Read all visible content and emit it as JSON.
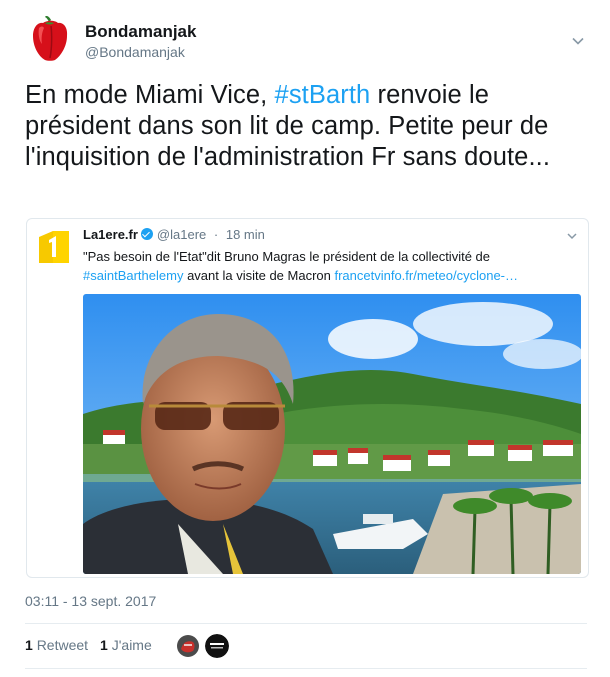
{
  "author": {
    "name": "Bondamanjak",
    "handle": "@Bondamanjak",
    "avatar_icon": "red-pepper-icon"
  },
  "tweet": {
    "text_before": "En mode Miami Vice, ",
    "hashtag": "#stBarth",
    "text_after": " renvoie le président dans son lit de camp. Petite peur de l'inquisition de l'administration Fr sans doute..."
  },
  "quoted": {
    "name": "La1ere.fr",
    "handle": "@la1ere",
    "separator": "·",
    "time": "18 min",
    "text_part1": "\"Pas besoin de l'Etat\"dit Bruno Magras le président de la collectivité de ",
    "hashtag": "#saintBarthelemy",
    "text_part2": " avant la visite de Macron ",
    "link": "francetvinfo.fr/meteo/cyclone-…",
    "logo_icon": "la1ere-logo-icon",
    "image_alt": "Man with sunglasses in front of harbor"
  },
  "timestamp": "03:11 - 13 sept. 2017",
  "stats": {
    "retweets_count": "1",
    "retweets_label": "Retweet",
    "likes_count": "1",
    "likes_label": "J'aime"
  },
  "colors": {
    "accent": "#1da1f2",
    "text": "#14171a",
    "muted": "#657786",
    "border": "#e1e8ed"
  }
}
